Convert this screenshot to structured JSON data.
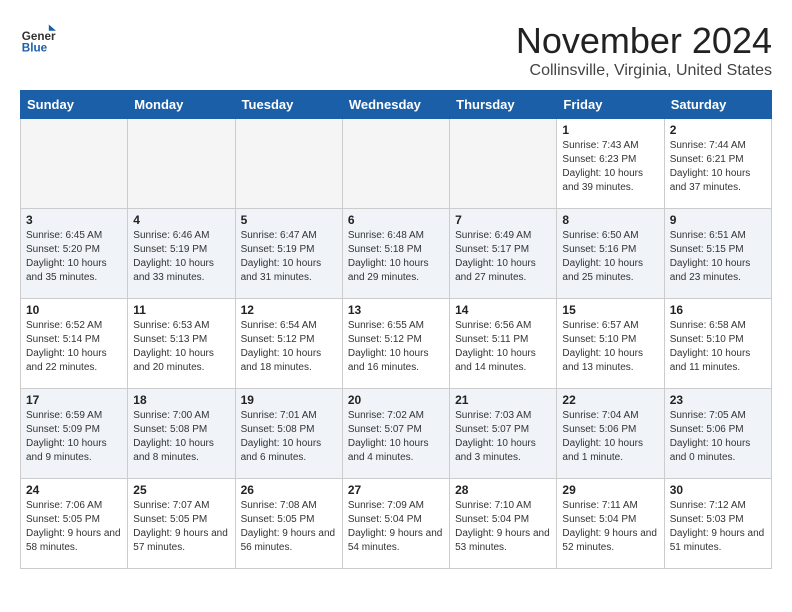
{
  "header": {
    "logo_general": "General",
    "logo_blue": "Blue",
    "month": "November 2024",
    "location": "Collinsville, Virginia, United States"
  },
  "weekdays": [
    "Sunday",
    "Monday",
    "Tuesday",
    "Wednesday",
    "Thursday",
    "Friday",
    "Saturday"
  ],
  "weeks": [
    [
      {
        "day": "",
        "info": ""
      },
      {
        "day": "",
        "info": ""
      },
      {
        "day": "",
        "info": ""
      },
      {
        "day": "",
        "info": ""
      },
      {
        "day": "",
        "info": ""
      },
      {
        "day": "1",
        "info": "Sunrise: 7:43 AM\nSunset: 6:23 PM\nDaylight: 10 hours and 39 minutes."
      },
      {
        "day": "2",
        "info": "Sunrise: 7:44 AM\nSunset: 6:21 PM\nDaylight: 10 hours and 37 minutes."
      }
    ],
    [
      {
        "day": "3",
        "info": "Sunrise: 6:45 AM\nSunset: 5:20 PM\nDaylight: 10 hours and 35 minutes."
      },
      {
        "day": "4",
        "info": "Sunrise: 6:46 AM\nSunset: 5:19 PM\nDaylight: 10 hours and 33 minutes."
      },
      {
        "day": "5",
        "info": "Sunrise: 6:47 AM\nSunset: 5:19 PM\nDaylight: 10 hours and 31 minutes."
      },
      {
        "day": "6",
        "info": "Sunrise: 6:48 AM\nSunset: 5:18 PM\nDaylight: 10 hours and 29 minutes."
      },
      {
        "day": "7",
        "info": "Sunrise: 6:49 AM\nSunset: 5:17 PM\nDaylight: 10 hours and 27 minutes."
      },
      {
        "day": "8",
        "info": "Sunrise: 6:50 AM\nSunset: 5:16 PM\nDaylight: 10 hours and 25 minutes."
      },
      {
        "day": "9",
        "info": "Sunrise: 6:51 AM\nSunset: 5:15 PM\nDaylight: 10 hours and 23 minutes."
      }
    ],
    [
      {
        "day": "10",
        "info": "Sunrise: 6:52 AM\nSunset: 5:14 PM\nDaylight: 10 hours and 22 minutes."
      },
      {
        "day": "11",
        "info": "Sunrise: 6:53 AM\nSunset: 5:13 PM\nDaylight: 10 hours and 20 minutes."
      },
      {
        "day": "12",
        "info": "Sunrise: 6:54 AM\nSunset: 5:12 PM\nDaylight: 10 hours and 18 minutes."
      },
      {
        "day": "13",
        "info": "Sunrise: 6:55 AM\nSunset: 5:12 PM\nDaylight: 10 hours and 16 minutes."
      },
      {
        "day": "14",
        "info": "Sunrise: 6:56 AM\nSunset: 5:11 PM\nDaylight: 10 hours and 14 minutes."
      },
      {
        "day": "15",
        "info": "Sunrise: 6:57 AM\nSunset: 5:10 PM\nDaylight: 10 hours and 13 minutes."
      },
      {
        "day": "16",
        "info": "Sunrise: 6:58 AM\nSunset: 5:10 PM\nDaylight: 10 hours and 11 minutes."
      }
    ],
    [
      {
        "day": "17",
        "info": "Sunrise: 6:59 AM\nSunset: 5:09 PM\nDaylight: 10 hours and 9 minutes."
      },
      {
        "day": "18",
        "info": "Sunrise: 7:00 AM\nSunset: 5:08 PM\nDaylight: 10 hours and 8 minutes."
      },
      {
        "day": "19",
        "info": "Sunrise: 7:01 AM\nSunset: 5:08 PM\nDaylight: 10 hours and 6 minutes."
      },
      {
        "day": "20",
        "info": "Sunrise: 7:02 AM\nSunset: 5:07 PM\nDaylight: 10 hours and 4 minutes."
      },
      {
        "day": "21",
        "info": "Sunrise: 7:03 AM\nSunset: 5:07 PM\nDaylight: 10 hours and 3 minutes."
      },
      {
        "day": "22",
        "info": "Sunrise: 7:04 AM\nSunset: 5:06 PM\nDaylight: 10 hours and 1 minute."
      },
      {
        "day": "23",
        "info": "Sunrise: 7:05 AM\nSunset: 5:06 PM\nDaylight: 10 hours and 0 minutes."
      }
    ],
    [
      {
        "day": "24",
        "info": "Sunrise: 7:06 AM\nSunset: 5:05 PM\nDaylight: 9 hours and 58 minutes."
      },
      {
        "day": "25",
        "info": "Sunrise: 7:07 AM\nSunset: 5:05 PM\nDaylight: 9 hours and 57 minutes."
      },
      {
        "day": "26",
        "info": "Sunrise: 7:08 AM\nSunset: 5:05 PM\nDaylight: 9 hours and 56 minutes."
      },
      {
        "day": "27",
        "info": "Sunrise: 7:09 AM\nSunset: 5:04 PM\nDaylight: 9 hours and 54 minutes."
      },
      {
        "day": "28",
        "info": "Sunrise: 7:10 AM\nSunset: 5:04 PM\nDaylight: 9 hours and 53 minutes."
      },
      {
        "day": "29",
        "info": "Sunrise: 7:11 AM\nSunset: 5:04 PM\nDaylight: 9 hours and 52 minutes."
      },
      {
        "day": "30",
        "info": "Sunrise: 7:12 AM\nSunset: 5:03 PM\nDaylight: 9 hours and 51 minutes."
      }
    ]
  ]
}
